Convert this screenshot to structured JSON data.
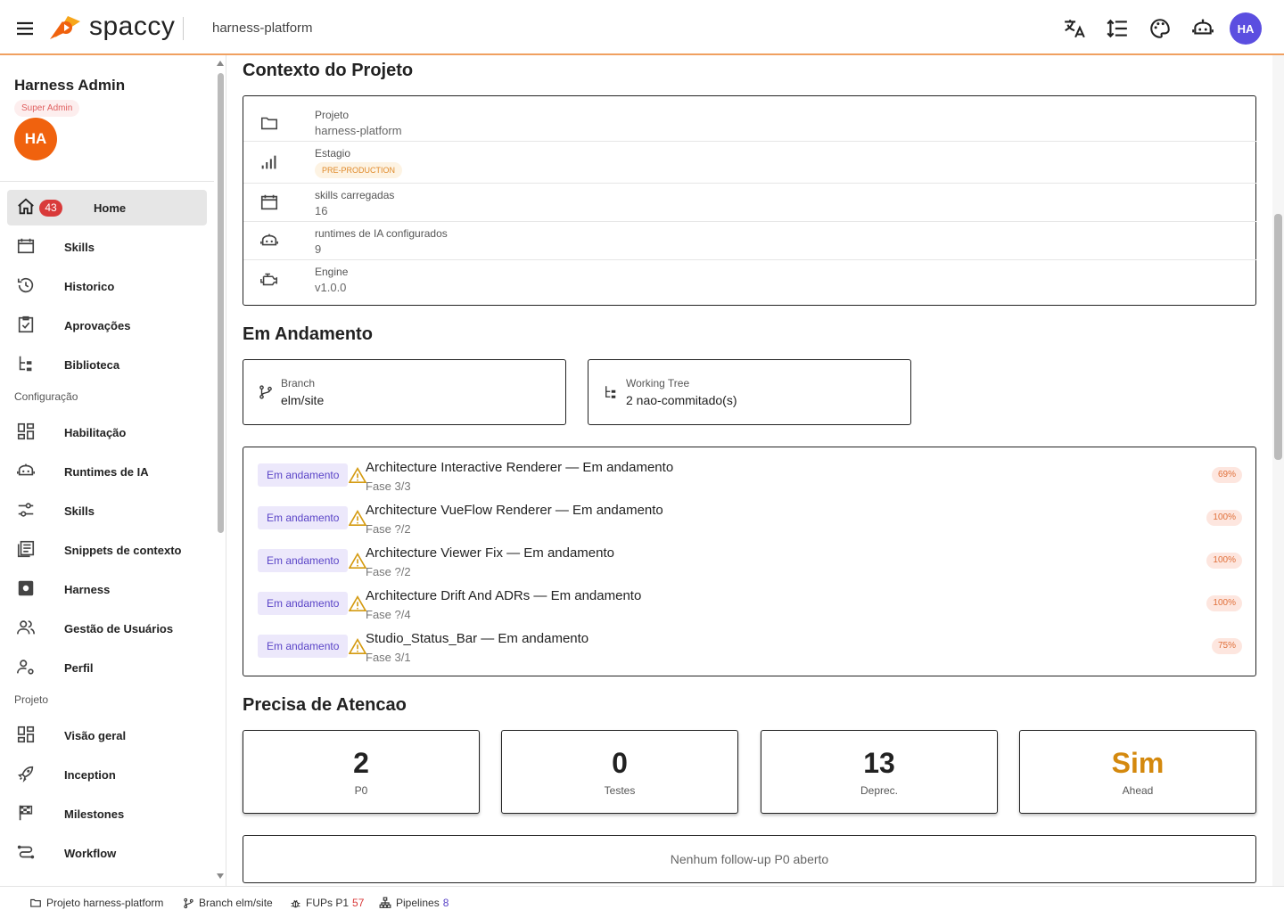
{
  "app": {
    "brand": "spaccy",
    "project_name": "harness-platform",
    "colors": {
      "accent": "#f0620e",
      "avatar_top": "#5b4ee0",
      "badge": "#d93a3a",
      "status_chip": "#5a44c7",
      "warning": "#e0a020"
    }
  },
  "header": {
    "avatar_initials": "HA",
    "icons": [
      "translate-icon",
      "line-height-icon",
      "palette-icon",
      "robot-icon"
    ]
  },
  "sidebar": {
    "user_name": "Harness Admin",
    "role": "Super Admin",
    "avatar_initials": "HA",
    "items": [
      {
        "label": "Home",
        "icon": "home-icon",
        "badge": "43",
        "active": true
      },
      {
        "label": "Skills",
        "icon": "calendar-icon"
      },
      {
        "label": "Historico",
        "icon": "history-icon"
      },
      {
        "label": "Aprovações",
        "icon": "clipboard-check-icon"
      },
      {
        "label": "Biblioteca",
        "icon": "tree-icon"
      }
    ],
    "section_config": "Configuração",
    "config_items": [
      {
        "label": "Habilitação",
        "icon": "dashboard-icon"
      },
      {
        "label": "Runtimes de IA",
        "icon": "robot-icon"
      },
      {
        "label": "Skills",
        "icon": "sliders-icon"
      },
      {
        "label": "Snippets de contexto",
        "icon": "document-list-icon"
      },
      {
        "label": "Harness",
        "icon": "chip-icon"
      },
      {
        "label": "Gestão de Usuários",
        "icon": "users-icon"
      },
      {
        "label": "Perfil",
        "icon": "user-gear-icon"
      }
    ],
    "section_project": "Projeto",
    "project_items": [
      {
        "label": "Visão geral",
        "icon": "dashboard-icon"
      },
      {
        "label": "Inception",
        "icon": "rocket-icon"
      },
      {
        "label": "Milestones",
        "icon": "flag-icon"
      },
      {
        "label": "Workflow",
        "icon": "workflow-icon"
      }
    ]
  },
  "context": {
    "title": "Contexto do Projeto",
    "rows": [
      {
        "label": "Projeto",
        "value": "harness-platform",
        "icon": "folder-icon"
      },
      {
        "label": "Estagio",
        "value": "PRE-PRODUCTION",
        "icon": "signal-bars-icon"
      },
      {
        "label": "skills carregadas",
        "value": "16",
        "icon": "calendar-icon"
      },
      {
        "label": "runtimes de IA configurados",
        "value": "9",
        "icon": "robot-icon"
      },
      {
        "label": "Engine",
        "value": "v1.0.0",
        "icon": "engine-icon"
      }
    ]
  },
  "in_progress": {
    "title": "Em Andamento",
    "branch": {
      "label": "Branch",
      "value": "elm/site"
    },
    "working_tree": {
      "label": "Working Tree",
      "value": "2 nao-commitado(s)"
    },
    "items": [
      {
        "status": "Em andamento",
        "title": "Architecture Interactive Renderer — Em andamento",
        "sub": "Fase 3/3",
        "pct": "69%"
      },
      {
        "status": "Em andamento",
        "title": "Architecture VueFlow Renderer — Em andamento",
        "sub": "Fase ?/2",
        "pct": "100%"
      },
      {
        "status": "Em andamento",
        "title": "Architecture Viewer Fix — Em andamento",
        "sub": "Fase ?/2",
        "pct": "100%"
      },
      {
        "status": "Em andamento",
        "title": "Architecture Drift And ADRs — Em andamento",
        "sub": "Fase ?/4",
        "pct": "100%"
      },
      {
        "status": "Em andamento",
        "title": "Studio_Status_Bar — Em andamento",
        "sub": "Fase 3/1",
        "pct": "75%"
      }
    ]
  },
  "attention": {
    "title": "Precisa de Atencao",
    "stats": [
      {
        "value": "2",
        "label": "P0"
      },
      {
        "value": "0",
        "label": "Testes"
      },
      {
        "value": "13",
        "label": "Deprec."
      },
      {
        "value": "Sim",
        "label": "Ahead",
        "color": "#d4890e"
      }
    ],
    "empty_message": "Nenhum follow-up P0 aberto"
  },
  "statusbar": {
    "project": "Projeto harness-platform",
    "branch": "Branch elm/site",
    "fups_label": "FUPs P1",
    "fups_count": "57",
    "pipelines_label": "Pipelines",
    "pipelines_count": "8"
  }
}
